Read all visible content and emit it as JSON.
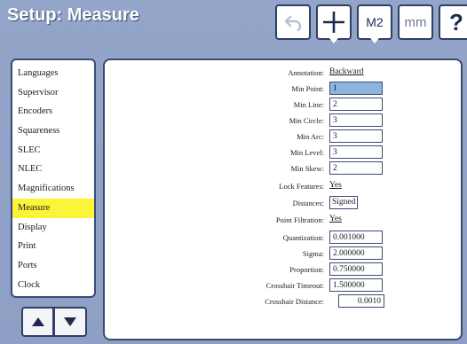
{
  "title": "Setup: Measure",
  "toolbar": {
    "undo_icon": "undo-icon",
    "crosshair_icon": "crosshair-icon",
    "m2_label": "M2",
    "mm_label": "mm",
    "help_label": "?"
  },
  "menu": {
    "items": [
      {
        "label": "Languages"
      },
      {
        "label": "Supervisor"
      },
      {
        "label": "Encoders"
      },
      {
        "label": "Squareness"
      },
      {
        "label": "SLEC"
      },
      {
        "label": "NLEC"
      },
      {
        "label": "Magnifications"
      },
      {
        "label": "Measure"
      },
      {
        "label": "Display"
      },
      {
        "label": "Print"
      },
      {
        "label": "Ports"
      },
      {
        "label": "Clock"
      }
    ],
    "selected": "Measure"
  },
  "settings": [
    {
      "label": "Annotation:",
      "value": "Backward"
    },
    {
      "label": "Min Point:",
      "value": "1"
    },
    {
      "label": "Min Line:",
      "value": "2"
    },
    {
      "label": "Min Circle:",
      "value": "3"
    },
    {
      "label": "Min Arc:",
      "value": "3"
    },
    {
      "label": "Min Level:",
      "value": "3"
    },
    {
      "label": "Min Skew:",
      "value": "2"
    },
    {
      "label": "Lock Features:",
      "value": "Yes"
    },
    {
      "label": "Distances:",
      "value": "Signed"
    },
    {
      "label": "Point Filtration:",
      "value": "Yes"
    },
    {
      "label": "Quantization:",
      "value": "0.001000"
    },
    {
      "label": "Sigma:",
      "value": "2.000000"
    },
    {
      "label": "Proportion:",
      "value": "0.750000"
    },
    {
      "label": "Crosshair Timeout:",
      "value": "1.500000"
    },
    {
      "label": "Crosshair Distance:",
      "value": "0.0010"
    }
  ],
  "colors": {
    "background": "#8fa1c6",
    "selected_menu": "#fbf53a",
    "selected_field": "#8fb3e0",
    "border": "#3a4b73"
  }
}
